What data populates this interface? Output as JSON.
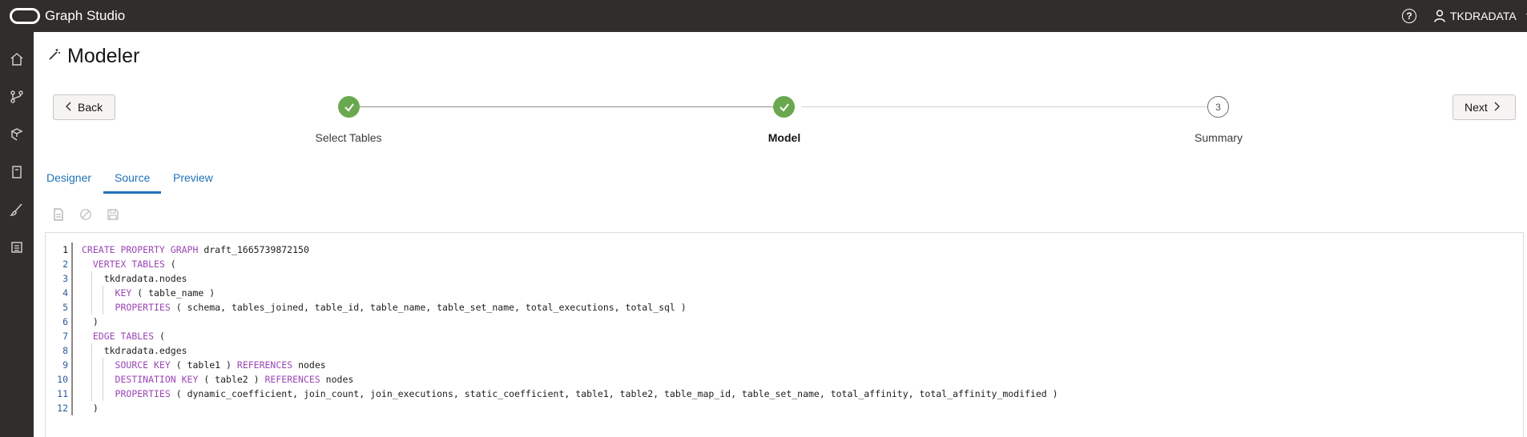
{
  "app": {
    "title": "Graph Studio",
    "user": "TKDRADATA"
  },
  "page": {
    "title": "Modeler"
  },
  "buttons": {
    "back": "Back",
    "next": "Next"
  },
  "steps": [
    {
      "label": "Select Tables",
      "state": "complete"
    },
    {
      "label": "Model",
      "state": "complete",
      "active": true
    },
    {
      "label": "Summary",
      "state": "pending",
      "number": "3"
    }
  ],
  "tabs": [
    {
      "label": "Designer"
    },
    {
      "label": "Source",
      "active": true
    },
    {
      "label": "Preview"
    }
  ],
  "toolbar": [
    {
      "icon": "document-icon"
    },
    {
      "icon": "cancel-icon"
    },
    {
      "icon": "save-icon"
    }
  ],
  "sidebar": [
    {
      "icon": "home-icon"
    },
    {
      "icon": "graph-branch-icon"
    },
    {
      "icon": "cube-icon"
    },
    {
      "icon": "notebook-icon"
    },
    {
      "icon": "brush-icon"
    },
    {
      "icon": "list-icon"
    }
  ],
  "editor": {
    "line_numbers": [
      "1",
      "2",
      "3",
      "4",
      "5",
      "6",
      "7",
      "8",
      "9",
      "10",
      "11",
      "12"
    ],
    "lines": [
      [
        {
          "t": "CREATE PROPERTY GRAPH",
          "k": 1
        },
        {
          "t": " draft_1665739872150"
        }
      ],
      [
        {
          "t": "  "
        },
        {
          "t": "VERTEX TABLES",
          "k": 1
        },
        {
          "t": " ("
        }
      ],
      [
        {
          "t": "    tkdradata.nodes"
        }
      ],
      [
        {
          "t": "      "
        },
        {
          "t": "KEY",
          "k": 1
        },
        {
          "t": " ( table_name )"
        }
      ],
      [
        {
          "t": "      "
        },
        {
          "t": "PROPERTIES",
          "k": 1
        },
        {
          "t": " ( schema, tables_joined, table_id, table_name, table_set_name, total_executions, total_sql )"
        }
      ],
      [
        {
          "t": "  )"
        }
      ],
      [
        {
          "t": "  "
        },
        {
          "t": "EDGE TABLES",
          "k": 1
        },
        {
          "t": " ("
        }
      ],
      [
        {
          "t": "    tkdradata.edges"
        }
      ],
      [
        {
          "t": "      "
        },
        {
          "t": "SOURCE KEY",
          "k": 1
        },
        {
          "t": " ( table1 ) "
        },
        {
          "t": "REFERENCES",
          "k": 1
        },
        {
          "t": " nodes"
        }
      ],
      [
        {
          "t": "      "
        },
        {
          "t": "DESTINATION KEY",
          "k": 1
        },
        {
          "t": " ( table2 ) "
        },
        {
          "t": "REFERENCES",
          "k": 1
        },
        {
          "t": " nodes"
        }
      ],
      [
        {
          "t": "      "
        },
        {
          "t": "PROPERTIES",
          "k": 1
        },
        {
          "t": " ( dynamic_coefficient, join_count, join_executions, static_coefficient, table1, table2, table_map_id, table_set_name, total_affinity, total_affinity_modified )"
        }
      ],
      [
        {
          "t": "  )"
        }
      ]
    ]
  },
  "colors": {
    "topbar": "#312d2a",
    "accent": "#2272b9",
    "step_done": "#6aa84f",
    "keyword": "#9a46b4"
  }
}
